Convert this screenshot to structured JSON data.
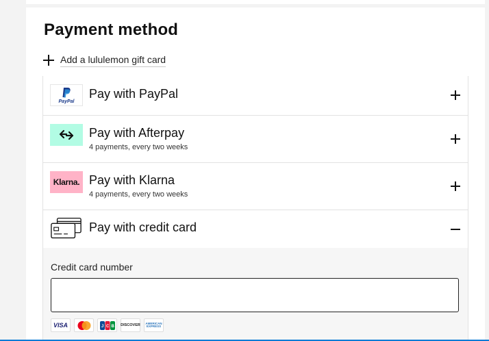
{
  "title": "Payment method",
  "gift_card_link": "Add a lululemon gift card",
  "methods": [
    {
      "label": "Pay with PayPal",
      "subtitle": "",
      "logo": "paypal-logo",
      "logo_text": "PayPal",
      "toggle": "plus"
    },
    {
      "label": "Pay with Afterpay",
      "subtitle": "4 payments, every two weeks",
      "logo": "afterpay-logo",
      "toggle": "plus"
    },
    {
      "label": "Pay with Klarna",
      "subtitle": "4 payments, every two weeks",
      "logo": "klarna-logo",
      "logo_text": "Klarna.",
      "toggle": "plus"
    },
    {
      "label": "Pay with credit card",
      "subtitle": "",
      "logo": "credit-card-icon",
      "toggle": "minus"
    }
  ],
  "credit_card_form": {
    "label": "Credit card number",
    "value": "",
    "placeholder": ""
  },
  "accepted_cards": [
    "VISA",
    "Mastercard",
    "JCB",
    "DISCOVER",
    "AMERICAN EXPRESS"
  ],
  "colors": {
    "afterpay_bg": "#b2fce4",
    "klarna_bg": "#ffb3c7",
    "paypal_blue": "#1a3a8a",
    "focus_line": "#0a7bd6"
  }
}
